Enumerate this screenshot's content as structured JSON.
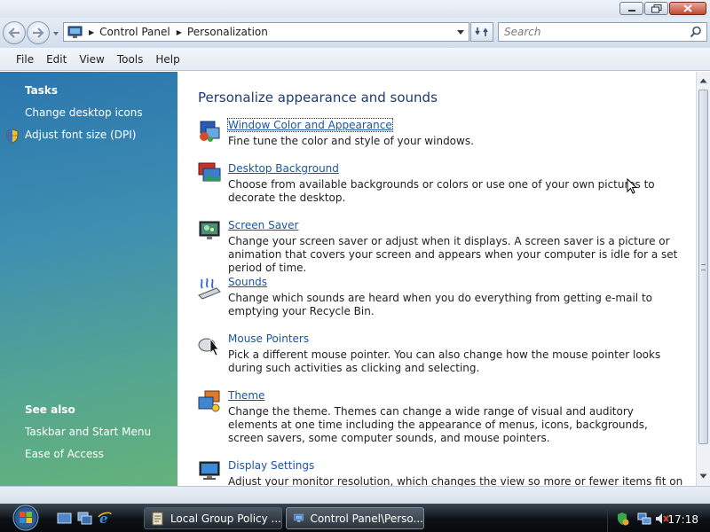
{
  "address": {
    "breadcrumb": [
      "Control Panel",
      "Personalization"
    ],
    "search_placeholder": "Search"
  },
  "menu": [
    "File",
    "Edit",
    "View",
    "Tools",
    "Help"
  ],
  "sidebar": {
    "tasks_heading": "Tasks",
    "tasks": [
      "Change desktop icons",
      "Adjust font size (DPI)"
    ],
    "see_also_heading": "See also",
    "see_also": [
      "Taskbar and Start Menu",
      "Ease of Access"
    ]
  },
  "content": {
    "title": "Personalize appearance and sounds",
    "items": [
      {
        "title": "Window Color and Appearance",
        "description": "Fine tune the color and style of your windows.",
        "icon": "window-color-icon"
      },
      {
        "title": "Desktop Background",
        "description": "Choose from available backgrounds or colors or use one of your own pictures to decorate the desktop.",
        "icon": "desktop-background-icon"
      },
      {
        "title": "Screen Saver",
        "description": "Change your screen saver or adjust when it displays. A screen saver is a picture or animation that covers your screen and appears when your computer is idle for a set period of time.",
        "icon": "screen-saver-icon"
      },
      {
        "title": "Sounds",
        "description": "Change which sounds are heard when you do everything from getting e-mail to emptying your Recycle Bin.",
        "icon": "sounds-icon"
      },
      {
        "title": "Mouse Pointers",
        "description": "Pick a different mouse pointer. You can also change how the mouse pointer looks during such activities as clicking and selecting.",
        "icon": "mouse-pointers-icon"
      },
      {
        "title": "Theme",
        "description": "Change the theme. Themes can change a wide range of visual and auditory elements at one time including the appearance of menus, icons, backgrounds, screen savers, some computer sounds, and mouse pointers.",
        "icon": "theme-icon"
      },
      {
        "title": "Display Settings",
        "description": "Adjust your monitor resolution, which changes the view so more or fewer items fit on the screen.",
        "icon": "display-settings-icon"
      }
    ]
  },
  "taskbar": {
    "tasks": [
      {
        "label": "Local Group Policy ..."
      },
      {
        "label": "Control Panel\\Perso..."
      }
    ],
    "clock": "17:18"
  },
  "colors": {
    "link": "#1a54a6",
    "title": "#1e3a6e",
    "sidebar_top": "#2b76ae",
    "sidebar_bottom": "#64b27a"
  }
}
